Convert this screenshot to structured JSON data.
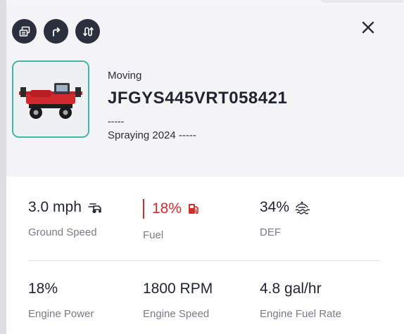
{
  "header": {
    "actions": [
      {
        "icon": "copy-window-icon"
      },
      {
        "icon": "redirect-arrow-icon"
      },
      {
        "icon": "swap-route-icon"
      }
    ],
    "close_icon": "close-icon"
  },
  "vehicle": {
    "status": "Moving",
    "id": "JFGYS445VRT058421",
    "placeholder": "-----",
    "operation": "Spraying 2024 -----",
    "thumbnail": "sprayer-vehicle-image"
  },
  "metrics": [
    {
      "value": "3.0 mph",
      "label": "Ground Speed",
      "icon": "speed-vehicle-icon",
      "alert": false
    },
    {
      "value": "18%",
      "label": "Fuel",
      "icon": "fuel-pump-icon",
      "alert": true,
      "alert_color": "#d42b2b"
    },
    {
      "value": "34%",
      "label": "DEF",
      "icon": "def-fluid-icon",
      "alert": false
    },
    {
      "value": "18%",
      "label": "Engine Power"
    },
    {
      "value": "1800 RPM",
      "label": "Engine Speed"
    },
    {
      "value": "4.8 gal/hr",
      "label": "Engine Fuel Rate"
    }
  ],
  "colors": {
    "accent_border": "#3db8a6",
    "button_bg": "#2c2f3e",
    "alert": "#d42b2b"
  }
}
